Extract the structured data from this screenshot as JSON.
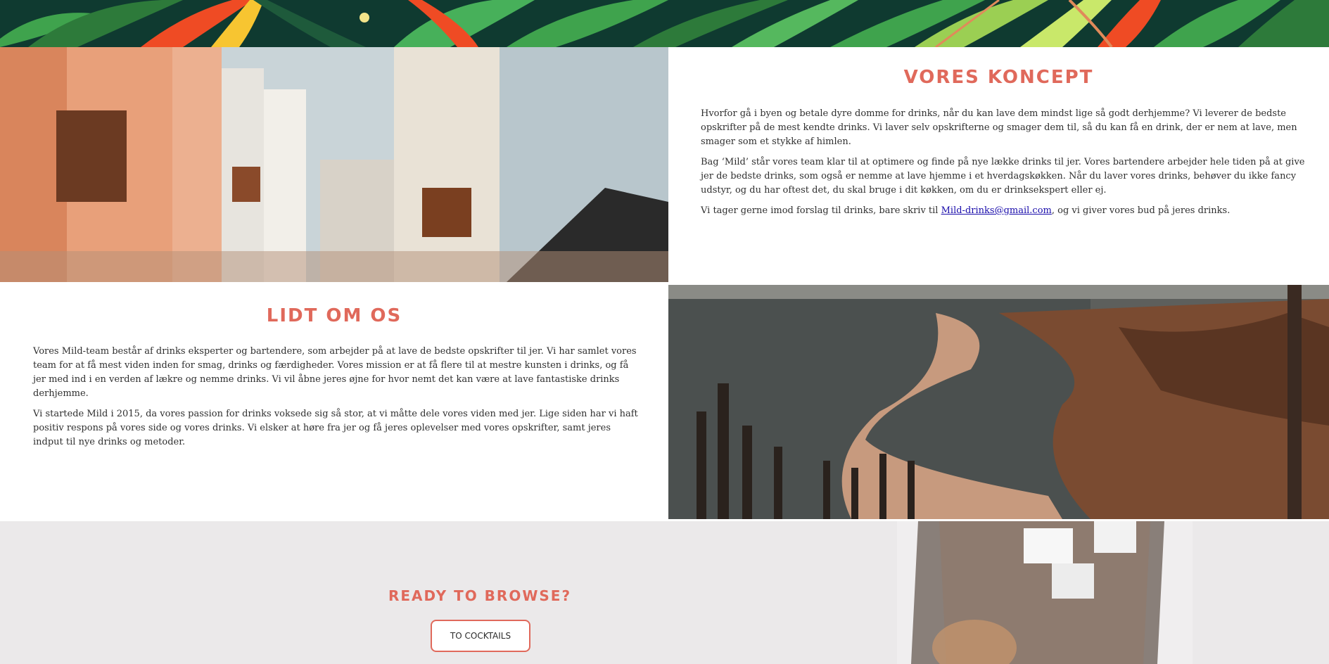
{
  "colors": {
    "accent": "#e0695b",
    "banner_dark": "#0f3a30",
    "leaf_green": "#3fa34d",
    "leaf_orange": "#ef4b24",
    "footer_bg": "#ebe9ea",
    "link": "#1a0dab"
  },
  "banner": {
    "image": "tropical-leaves-banner"
  },
  "street_photo": {
    "image": "colorful-street-balconies-photo"
  },
  "coast_photo": {
    "image": "coastal-promenade-cactus-photo"
  },
  "koncept": {
    "title": "VORES KONCEPT",
    "p1": "Hvorfor gå i byen og betale dyre domme for drinks, når du kan lave dem mindst lige så godt derhjemme? Vi leverer de bedste opskrifter på de mest kendte drinks. Vi laver selv opskrifterne og smager dem til, så du kan få en drink, der er nem at lave, men smager som et stykke af himlen.",
    "p2": "Bag ‘Mild’ står vores team klar til at optimere og finde på nye lække drinks til jer. Vores bartendere arbejder hele tiden på at give jer de bedste drinks, som også er nemme at lave hjemme i et hverdagskøkken. Når du laver vores drinks, behøver du ikke fancy udstyr, og du har oftest det, du skal bruge i dit køkken, om du er drinksekspert eller ej.",
    "p3_before": "Vi tager gerne imod forslag til drinks, bare skriv til ",
    "p3_link": "Mild-drinks@gmail.com",
    "p3_after": ", og vi giver vores bud på jeres drinks."
  },
  "omos": {
    "title": "LIDT OM OS",
    "p1": "Vores Mild-team består af drinks eksperter og bartendere, som arbejder på at lave de bedste opskrifter til jer. Vi har samlet vores team for at få mest viden inden for smag, drinks og færdigheder. Vores mission er at få flere til at mestre kunsten i drinks, og få jer med ind i en verden af lækre og nemme drinks. Vi vil åbne jeres øjne for hvor nemt det kan være at lave fantastiske drinks derhjemme.",
    "p2": "Vi startede Mild i 2015, da vores passion for drinks voksede sig så stor, at vi måtte dele vores viden med jer. Lige siden har vi haft positiv respons på vores side og vores drinks. Vi elsker at høre fra jer og få jeres oplevelser med vores opskrifter, samt jeres indput til nye drinks og metoder."
  },
  "browse": {
    "title": "READY TO BROWSE?",
    "button_label": "TO COCKTAILS",
    "image": "cocktail-glass-ice-photo"
  }
}
